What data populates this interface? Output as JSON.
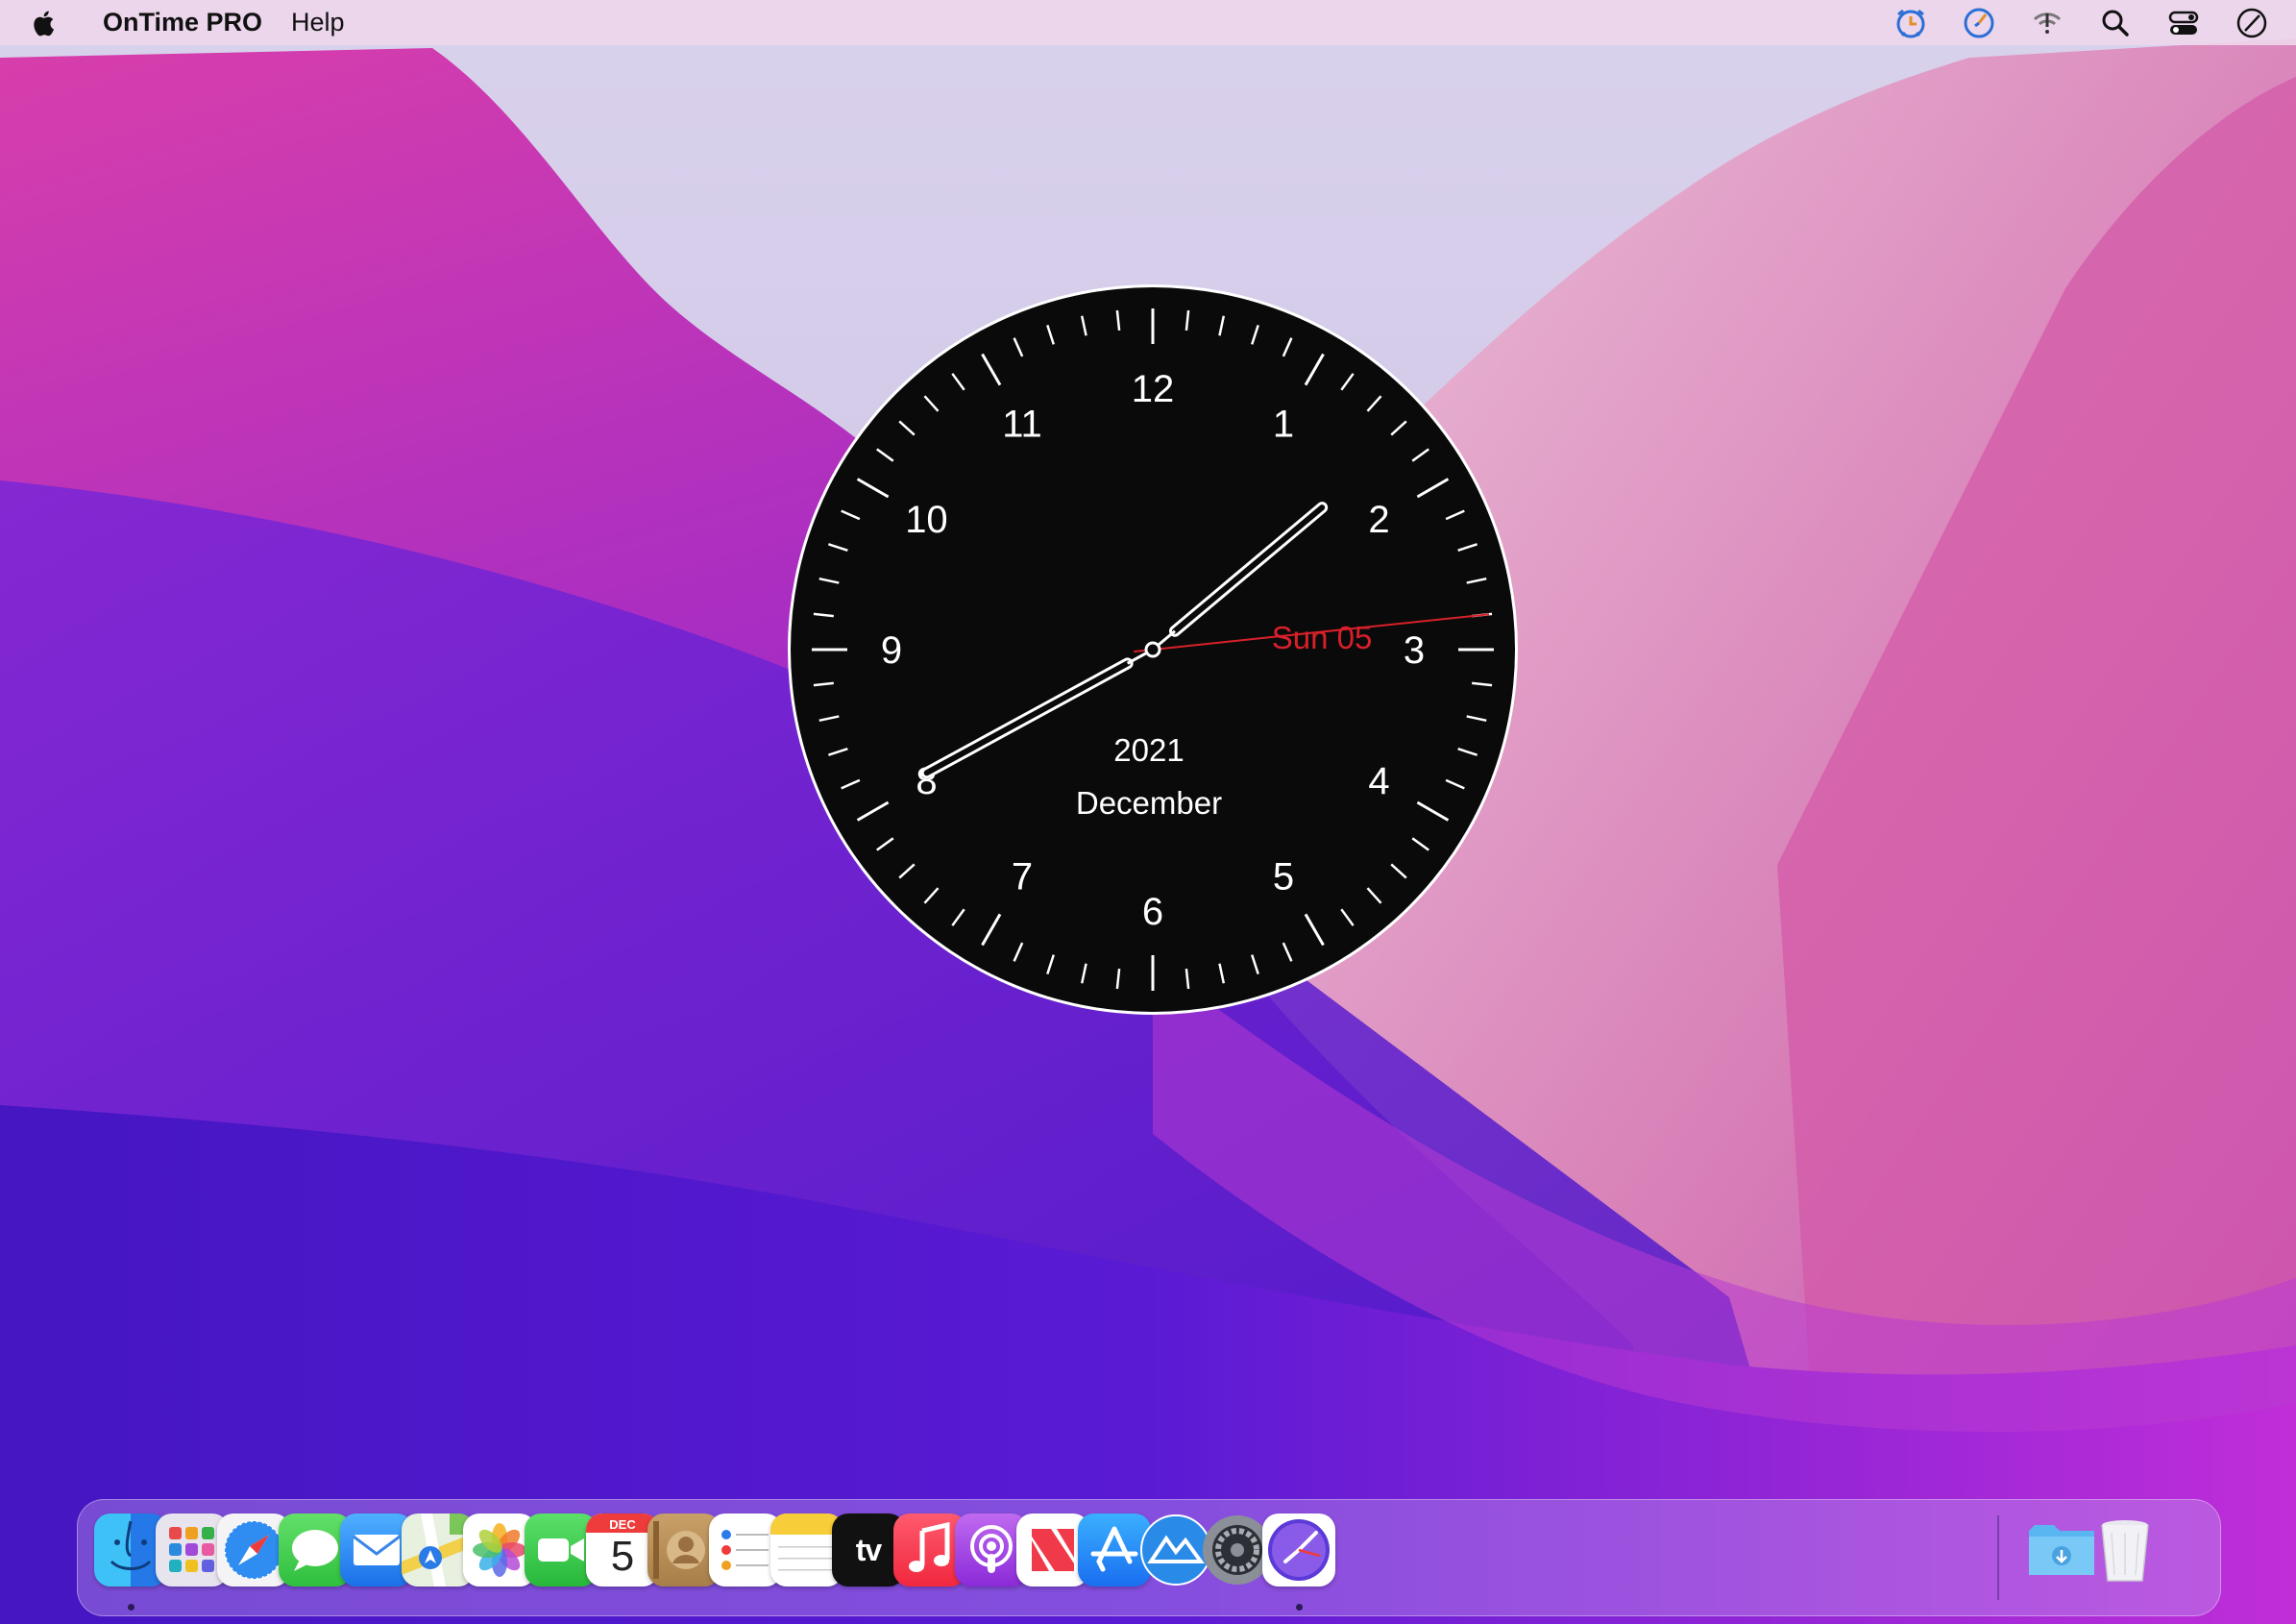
{
  "menubar": {
    "apple_icon": "apple-logo-icon",
    "app_name": "OnTime PRO",
    "menus": [
      "Help"
    ],
    "status_icons": [
      "ontime-alarm-icon",
      "ontime-clock-icon",
      "wifi-icon",
      "search-icon",
      "control-center-icon",
      "clock-status-icon"
    ]
  },
  "clock": {
    "numerals": [
      "12",
      "1",
      "2",
      "3",
      "4",
      "5",
      "6",
      "7",
      "8",
      "9",
      "10",
      "11"
    ],
    "day_text": "Sun 05",
    "year_text": "2021",
    "month_text": "December",
    "time": {
      "hour": 1,
      "minute": 40,
      "second": 14
    },
    "colors": {
      "face": "#0a0a0a",
      "ink": "#ffffff",
      "second_hand": "#d8202a"
    }
  },
  "dock": {
    "apps": [
      {
        "name": "Finder",
        "icon": "finder-icon",
        "running": true
      },
      {
        "name": "Launchpad",
        "icon": "launchpad-icon",
        "running": false
      },
      {
        "name": "Safari",
        "icon": "safari-icon",
        "running": false
      },
      {
        "name": "Messages",
        "icon": "messages-icon",
        "running": false
      },
      {
        "name": "Mail",
        "icon": "mail-icon",
        "running": false
      },
      {
        "name": "Maps",
        "icon": "maps-icon",
        "running": false
      },
      {
        "name": "Photos",
        "icon": "photos-icon",
        "running": false
      },
      {
        "name": "FaceTime",
        "icon": "facetime-icon",
        "running": false
      },
      {
        "name": "Calendar",
        "icon": "calendar-icon",
        "running": false,
        "month": "DEC",
        "day": "5"
      },
      {
        "name": "Contacts",
        "icon": "contacts-icon",
        "running": false
      },
      {
        "name": "Reminders",
        "icon": "reminders-icon",
        "running": false
      },
      {
        "name": "Notes",
        "icon": "notes-icon",
        "running": false
      },
      {
        "name": "TV",
        "icon": "appletv-icon",
        "running": false,
        "label": "tv"
      },
      {
        "name": "Music",
        "icon": "music-icon",
        "running": false
      },
      {
        "name": "Podcasts",
        "icon": "podcasts-icon",
        "running": false
      },
      {
        "name": "News",
        "icon": "news-icon",
        "running": false
      },
      {
        "name": "App Store",
        "icon": "app-store-icon",
        "running": false
      },
      {
        "name": "Monterey Installer",
        "icon": "mountain-icon",
        "running": false
      },
      {
        "name": "System Preferences",
        "icon": "system-preferences-icon",
        "running": false
      },
      {
        "name": "OnTime PRO",
        "icon": "ontime-pro-icon",
        "running": true
      }
    ],
    "downloads_icon": "downloads-folder-icon",
    "trash_icon": "trash-icon"
  }
}
